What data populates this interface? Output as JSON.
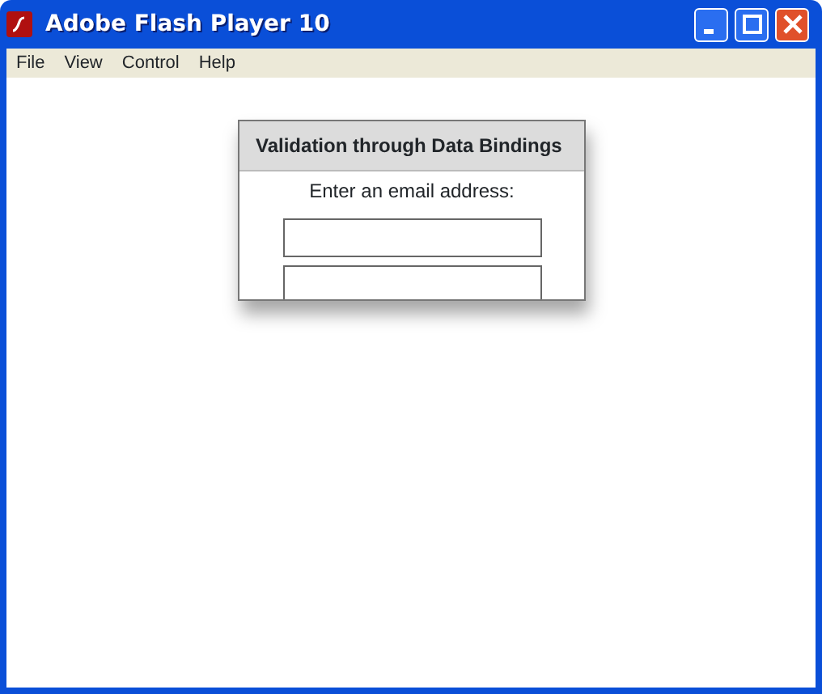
{
  "window": {
    "title": "Adobe Flash Player 10"
  },
  "menu": [
    "File",
    "View",
    "Control",
    "Help"
  ],
  "panel": {
    "title": "Validation through Data Bindings",
    "prompt": "Enter an email address:",
    "fields": [
      {
        "kind": "input"
      },
      {
        "kind": "input"
      }
    ]
  }
}
